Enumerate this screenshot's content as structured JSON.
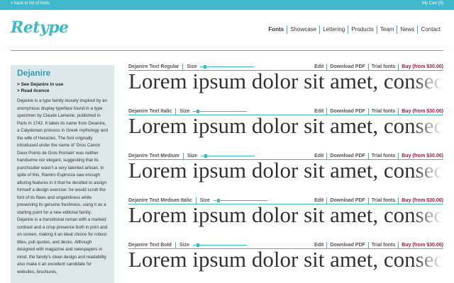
{
  "topbar": {
    "back_link": "< back to list of fonts",
    "cart": "My Cart (0)"
  },
  "header": {
    "logo": "Retype",
    "nav": [
      "Fonts",
      "Showcase",
      "Lettering",
      "Products",
      "Team",
      "News",
      "Contact"
    ]
  },
  "sidebar": {
    "title": "Dejanire",
    "links": [
      "> See Dejanire in use",
      "> Read licence"
    ],
    "description": "Dejanire is a type family loosely inspired by an anonymous display typeface found in a type specimen by Claude Lamesle, published in Paris in 1742. It takes its name from Deianira, a Calydonian princess in Greek mythology and the wife of Heracles. The font originally introduced under the name of 'Gros Canon Deux Points de Gros Romain' was neither handsome nor elegant, suggesting that its punchcutter wasn't a very talented artisan. In spite of this, Ramiro Espinoza saw enough alluring features in it that he decided to assign himself a design exercise: he would scrub the font of its flaws and ungainliness while preserving its genuine freshness, using it as a starting point for a new editorial family. Dejanire is a transitional roman with a marked contrast and a crisp presence both in print and on screen, making it an ideal choice for robust titles, pull quotes, and decks. Although designed with magazine and newspapers in mind, the family's clean design and readability also make it an excellent candidate for websites, brochures,"
  },
  "rows": [
    {
      "name": "Dejanire Text Regular",
      "size_label": "Size",
      "size_value": 0.05,
      "sample": "Lorem ipsum dolor sit amet, consectetur adipiscing elit"
    },
    {
      "name": "Dejanire Text Italic",
      "size_label": "Size",
      "size_value": 0.05,
      "sample": "Lorem ipsum dolor sit amet, consectetur adipiscing elit"
    },
    {
      "name": "Dejanire Text Medium",
      "size_label": "Size",
      "size_value": 0.05,
      "sample": "Lorem ipsum dolor sit amet, consectetur adipiscing elit"
    },
    {
      "name": "Dejanire Text Medium Italic",
      "size_label": "Size",
      "size_value": 0.05,
      "sample": "Lorem ipsum dolor sit amet, consectetur adipiscing elit"
    },
    {
      "name": "Dejanire Text Bold",
      "size_label": "Size",
      "size_value": 0.05,
      "sample": "Lorem ipsum dolor sit amet, consectetur adipiscing elit"
    }
  ],
  "actions": {
    "edit": "Edit",
    "download": "Download PDF",
    "trial": "Trial fonts",
    "buy": "Buy (from $30.00)"
  },
  "colors": {
    "accent": "#3fb8c9",
    "buy": "#a3183e",
    "sidebar_bg": "#dde6ea"
  }
}
